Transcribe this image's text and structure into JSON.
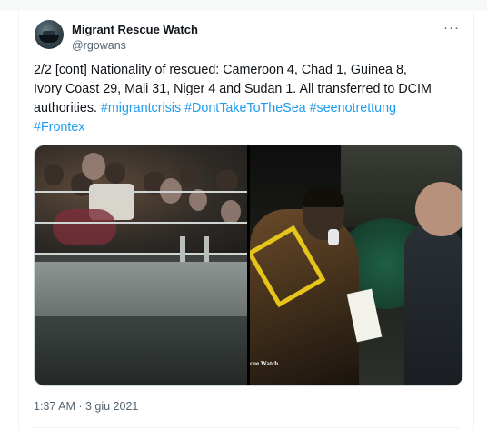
{
  "tweet": {
    "author_name": "Migrant Rescue Watch",
    "author_handle": "@rgowans",
    "more_icon": "ellipsis-icon",
    "text_plain": "2/2 [cont] Nationality of rescued: Cameroon 4, Chad 1, Guinea 8, Ivory Coast 29, Mali 31, Niger 4 and Sudan 1. All transferred to DCIM authorities. ",
    "hashtags": [
      "#migrantcrisis",
      "#DontTakeToTheSea",
      "#seenotrettung",
      "#Frontex"
    ],
    "photo_watermark": "cue Watch",
    "timestamp": "1:37 AM · 3 giu 2021"
  }
}
